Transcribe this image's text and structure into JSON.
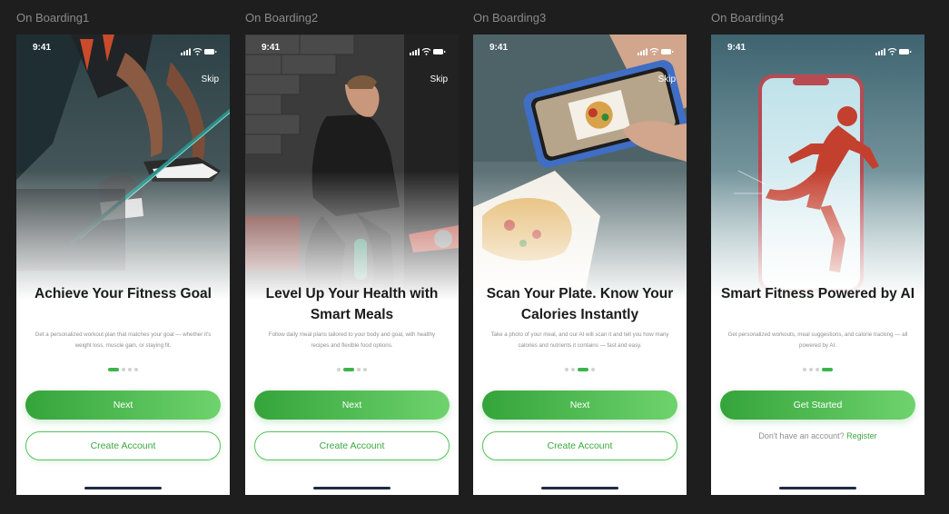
{
  "status": {
    "time": "9:41"
  },
  "screens": [
    {
      "label": "On Boarding1",
      "skip": "Skip",
      "title": "Achieve Your Fitness Goal",
      "description": "Get a personalized workout plan that matches your goal — whether it's weight loss, muscle gain, or staying fit.",
      "primary_button": "Next",
      "secondary_button": "Create Account",
      "page_index": 1
    },
    {
      "label": "On Boarding2",
      "skip": "Skip",
      "title": "Level Up Your Health with Smart Meals",
      "description": "Follow daily meal plans tailored to your body and goal, with healthy recipes and flexible food options.",
      "primary_button": "Next",
      "secondary_button": "Create Account",
      "page_index": 2
    },
    {
      "label": "On Boarding3",
      "skip": "Skip",
      "title": "Scan Your Plate. Know Your Calories Instantly",
      "description": "Take a photo of your meal, and our AI will scan it and tell you how many calories and nutrients it contains — fast and easy.",
      "primary_button": "Next",
      "secondary_button": "Create Account",
      "page_index": 3
    },
    {
      "label": "On Boarding4",
      "title": "Smart Fitness Powered by AI",
      "description": "Get personalized workouts, meal suggestions, and calorie tracking — all powered by AI.",
      "primary_button": "Get Started",
      "account_prompt": "Don't have an account?",
      "register_link": "Register",
      "page_index": 4
    }
  ],
  "page_count": 4,
  "colors": {
    "accent": "#3cb54a",
    "accent_light": "#6fd36d",
    "canvas": "#1e1e1e"
  }
}
